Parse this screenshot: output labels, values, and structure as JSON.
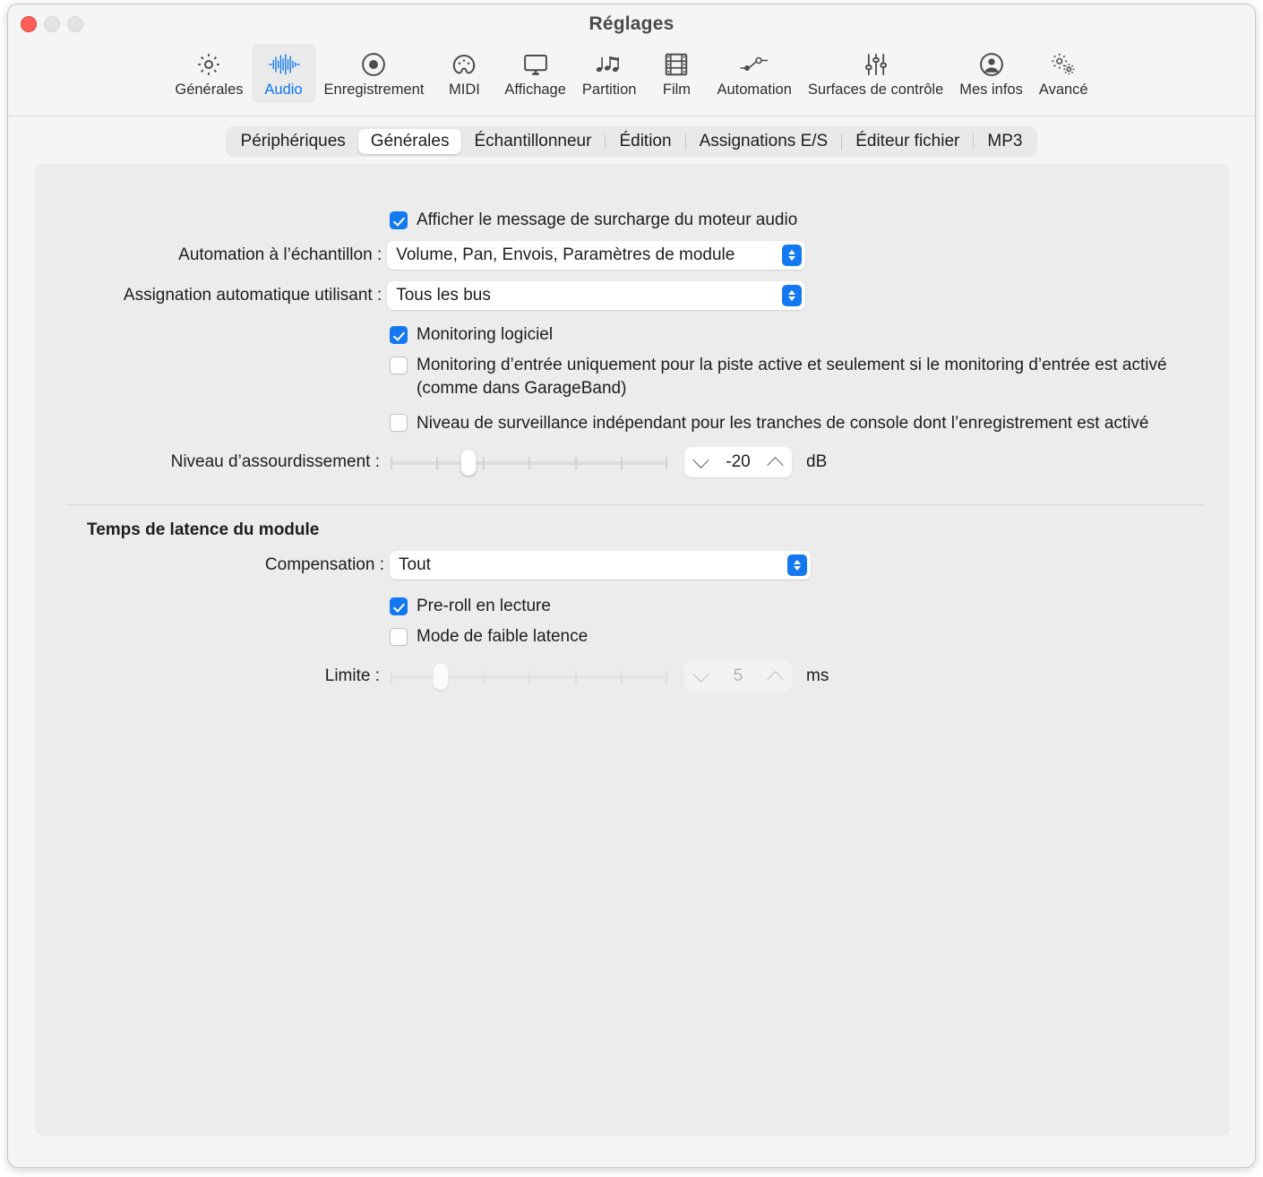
{
  "window": {
    "title": "Réglages",
    "traffic_lights": [
      "close-button",
      "minimize-button",
      "maximize-button"
    ]
  },
  "toolbar": {
    "items": [
      {
        "label": "Générales",
        "icon": "gear-icon",
        "selected": false
      },
      {
        "label": "Audio",
        "icon": "waveform-icon",
        "selected": true
      },
      {
        "label": "Enregistrement",
        "icon": "record-circle-icon",
        "selected": false
      },
      {
        "label": "MIDI",
        "icon": "midi-plug-icon",
        "selected": false
      },
      {
        "label": "Affichage",
        "icon": "display-monitor-icon",
        "selected": false
      },
      {
        "label": "Partition",
        "icon": "music-notes-icon",
        "selected": false
      },
      {
        "label": "Film",
        "icon": "film-strip-icon",
        "selected": false
      },
      {
        "label": "Automation",
        "icon": "automation-node-icon",
        "selected": false
      },
      {
        "label": "Surfaces de contrôle",
        "icon": "faders-icon",
        "selected": false
      },
      {
        "label": "Mes infos",
        "icon": "person-circle-icon",
        "selected": false
      },
      {
        "label": "Avancé",
        "icon": "double-gear-icon",
        "selected": false
      }
    ],
    "accent_color": "#0a76f0"
  },
  "tabs": [
    {
      "label": "Périphériques",
      "active": false,
      "separator_after": false
    },
    {
      "label": "Générales",
      "active": true,
      "separator_after": false
    },
    {
      "label": "Échantillonneur",
      "active": false,
      "separator_after": true
    },
    {
      "label": "Édition",
      "active": false,
      "separator_after": true
    },
    {
      "label": "Assignations E/S",
      "active": false,
      "separator_after": true
    },
    {
      "label": "Éditeur fichier",
      "active": false,
      "separator_after": true
    },
    {
      "label": "MP3",
      "active": false,
      "separator_after": false
    }
  ],
  "general": {
    "overload_checkbox": {
      "label": "Afficher le message de surcharge du moteur audio",
      "checked": true
    },
    "sample_automation": {
      "label": "Automation à l’échantillon :",
      "value": "Volume, Pan, Envois, Paramètres de module"
    },
    "auto_assign": {
      "label": "Assignation automatique utilisant :",
      "value": "Tous les bus"
    },
    "software_monitoring": {
      "label": "Monitoring logiciel",
      "checked": true
    },
    "input_monitoring": {
      "label": "Monitoring d’entrée uniquement pour la piste active et seulement si le monitoring d’entrée est activé (comme dans GarageBand)",
      "checked": false
    },
    "independent_monitoring": {
      "label": "Niveau de surveillance indépendant pour les tranches de console dont l’enregistrement est activé",
      "checked": false
    },
    "dim_level": {
      "label": "Niveau d’assourdissement :",
      "value": "-20",
      "unit": "dB",
      "slider_percent": 28,
      "tick_count": 7,
      "disabled": false
    }
  },
  "plugin_latency": {
    "section_title": "Temps de latence du module",
    "compensation": {
      "label": "Compensation :",
      "value": "Tout"
    },
    "preroll": {
      "label": "Pre-roll en lecture",
      "checked": true
    },
    "low_latency_mode": {
      "label": "Mode de faible latence",
      "checked": false
    },
    "limit": {
      "label": "Limite :",
      "value": "5",
      "unit": "ms",
      "slider_percent": 18,
      "tick_count": 7,
      "disabled": true
    }
  },
  "colors": {
    "accent": "#1479f0",
    "window_bg": "#f5f5f5",
    "panel_bg": "#ececec",
    "text": "#1d1d1d",
    "close_red": "#ff5f57"
  }
}
